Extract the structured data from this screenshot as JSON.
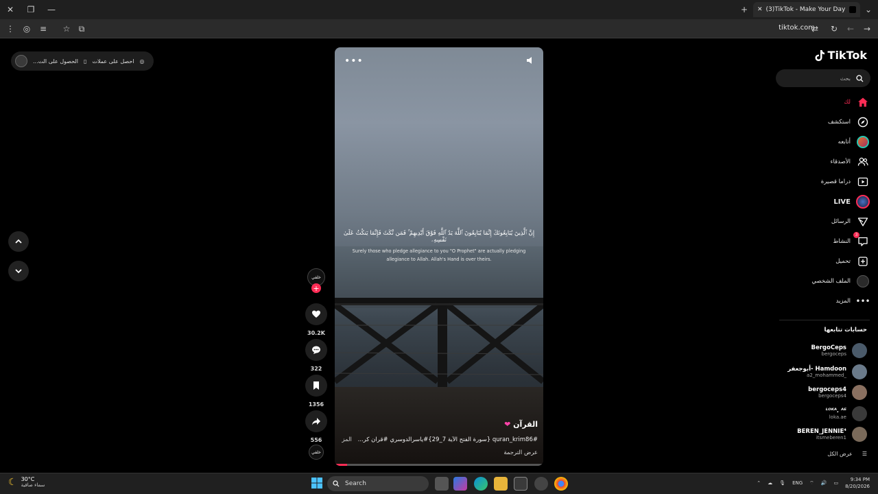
{
  "browser": {
    "tab_title": "(3)TikTok - Make Your Day",
    "url": "tiktok.com"
  },
  "promo": {
    "label_1": "احصل على عملات",
    "label_2": "الحصول على الت..."
  },
  "video": {
    "arabic_verse": "إِنَّ ٱلَّذِينَ يُبَايِعُونَكَ إِنَّمَا يُبَايِعُونَ ٱللَّهَ يَدُ ٱللَّهِ فَوْقَ أَيْدِيهِمْ ۚ فَمَن نَّكَثَ فَإِنَّمَا يَنكُثُ عَلَىٰ نَفْسِهِۦ",
    "english_verse": "Surely those who pledge allegiance to you \"O Prophet\" are actually pledging allegiance to Allah. Allah's Hand is over theirs.",
    "author": "القرآن",
    "caption": "#quran_krim86 {سورة الفتح الآية 7_29}#ياسرالدوسري #قران كر...",
    "caption_more": "المزيد",
    "translate": "عرض الترجمة",
    "progress": 0.06
  },
  "actions": {
    "creator_label": "خلفي",
    "likes": "30.2K",
    "comments": "322",
    "saves": "1356",
    "shares": "556",
    "music_label": "خلفي"
  },
  "sidebar": {
    "logo": "TikTok",
    "search_placeholder": "بحث",
    "nav": [
      {
        "label": "لك",
        "active": true
      },
      {
        "label": "استكشف"
      },
      {
        "label": "أتابعه"
      },
      {
        "label": "الأصدقاء"
      },
      {
        "label": "دراما قصيرة"
      },
      {
        "label": "LIVE"
      },
      {
        "label": "الرسائل"
      },
      {
        "label": "النشاط",
        "badge": "3"
      },
      {
        "label": "تحميل"
      },
      {
        "label": "الملف الشخصي"
      },
      {
        "label": "المزيد"
      }
    ],
    "following_title": "حسابات تتابعها",
    "accounts": [
      {
        "name": "BergoCeps",
        "handle": "bergoceps",
        "color": "#4a5a6a"
      },
      {
        "name": "أبوجعفر- Hamdoon",
        "handle": "a2_mohammed_",
        "color": "#6a7a8a"
      },
      {
        "name": "bergoceps4",
        "handle": "bergoceps4",
        "color": "#8a7060"
      },
      {
        "name": "ᴸᴼᴷᴬ. ᴬᴱ",
        "handle": "loka.ae",
        "color": "#3a3a3a"
      },
      {
        "name": "BEREN_JENNIE⁴",
        "handle": "itsmeberen1",
        "color": "#7a6a5a"
      }
    ],
    "see_all": "عرض الكل"
  },
  "taskbar": {
    "temperature": "30°C",
    "weather": "سماء صافية",
    "search": "Search",
    "lang": "ENG",
    "time": "9:34 PM",
    "date": "8/20/2026"
  },
  "colors": {
    "accent": "#fe2c55"
  }
}
